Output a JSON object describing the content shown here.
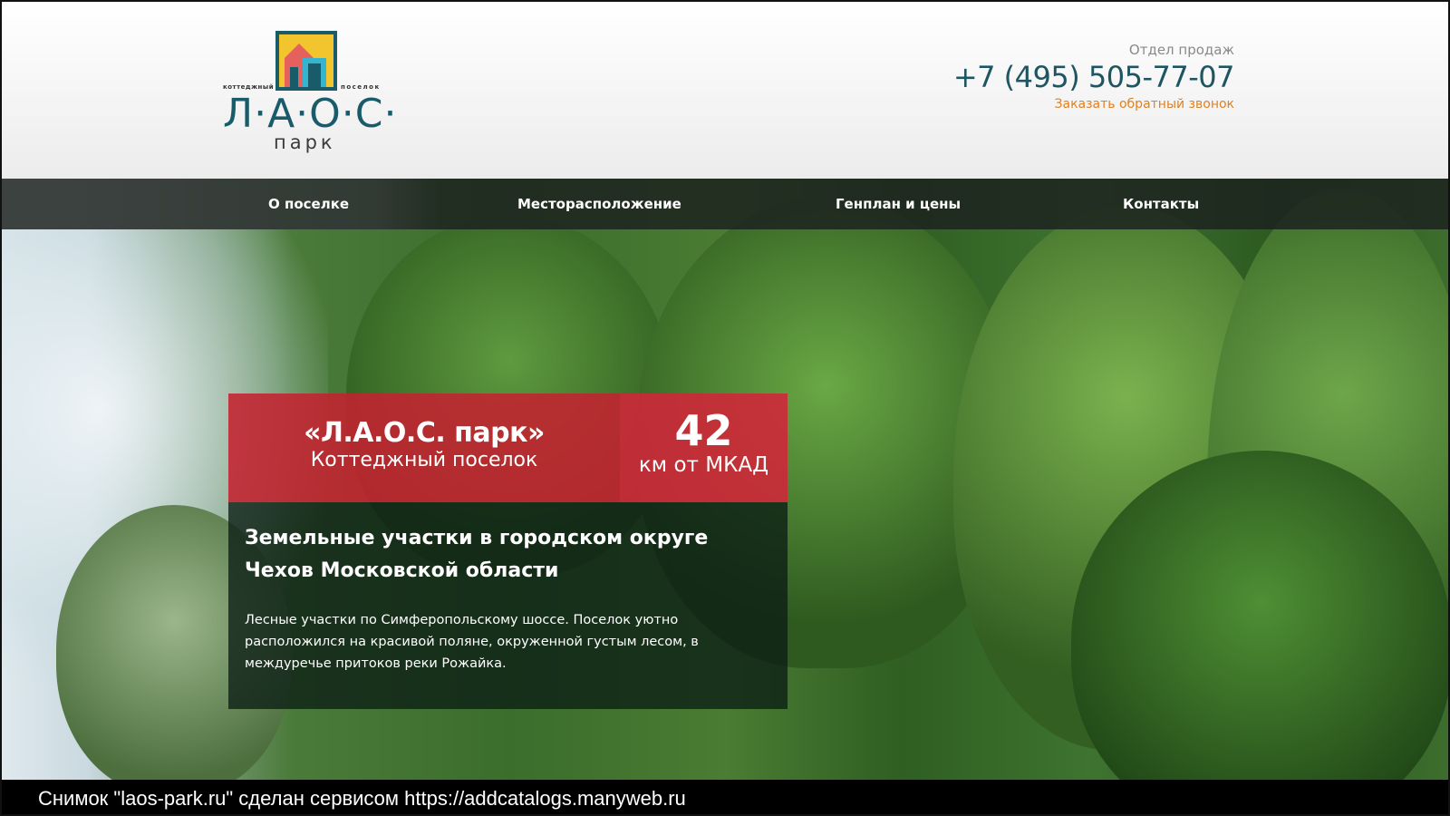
{
  "header": {
    "logo": {
      "small_left": "коттеджный",
      "small_right": "поселок",
      "wordmark": "Л·А·О·С·",
      "park": "парк"
    },
    "contact": {
      "department": "Отдел продаж",
      "phone": "+7 (495) 505-77-07",
      "callback_label": "Заказать обратный звонок"
    }
  },
  "nav": {
    "items": [
      {
        "label": "О поселке",
        "active": true
      },
      {
        "label": "Месторасположение",
        "active": false
      },
      {
        "label": "Генплан и цены",
        "active": false
      },
      {
        "label": "Контакты",
        "active": false
      }
    ]
  },
  "card": {
    "name": "«Л.А.О.С. парк»",
    "subtitle": "Коттеджный поселок",
    "distance_value": "42",
    "distance_unit": "км от МКАД",
    "heading": "Земельные участки в городском округе Чехов Московской области",
    "description": "Лесные участки по Симферопольскому шоссе. Поселок уютно расположился на красивой поляне, окруженной густым лесом, в междуречье притоков реки Рожайка."
  },
  "strip": {
    "text": "Снимок \"laos-park.ru\" сделан сервисом https://addcatalogs.manyweb.ru"
  },
  "colors": {
    "logo_teal": "#1a5b6a",
    "phone": "#1f5561",
    "callback_orange": "#e0801f",
    "card_red": "#c42230",
    "nav_dark": "#1c221e"
  }
}
